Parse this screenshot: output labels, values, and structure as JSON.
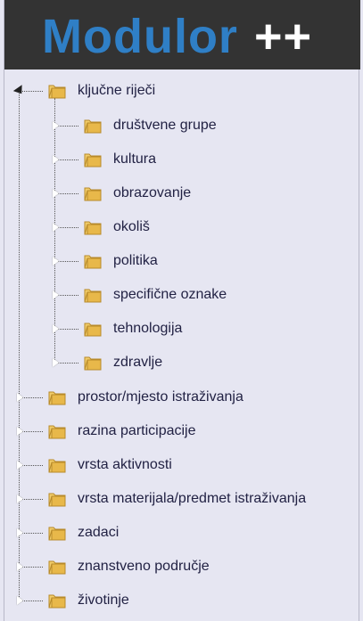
{
  "header": {
    "logo_word": "Modulor",
    "logo_plus": "++"
  },
  "tree": {
    "root": {
      "label": "ključne riječi",
      "children": [
        {
          "label": "društvene grupe"
        },
        {
          "label": "kultura"
        },
        {
          "label": "obrazovanje"
        },
        {
          "label": "okoliš"
        },
        {
          "label": "politika"
        },
        {
          "label": "specifične oznake"
        },
        {
          "label": "tehnologija"
        },
        {
          "label": "zdravlje"
        }
      ]
    },
    "siblings": [
      {
        "label": "prostor/mjesto istraživanja"
      },
      {
        "label": "razina participacije"
      },
      {
        "label": "vrsta aktivnosti"
      },
      {
        "label": "vrsta materijala/predmet istraživanja"
      },
      {
        "label": "zadaci"
      },
      {
        "label": "znanstveno područje"
      },
      {
        "label": "životinje"
      }
    ]
  },
  "colors": {
    "logo_blue": "#2f7fc6",
    "header_bg": "#333333",
    "panel_bg": "#e6e6f2",
    "folder": "#e8b84a"
  },
  "icons": {
    "node": "folder-icon",
    "expanded": "triangle-down-icon",
    "collapsed": "triangle-right-icon"
  }
}
